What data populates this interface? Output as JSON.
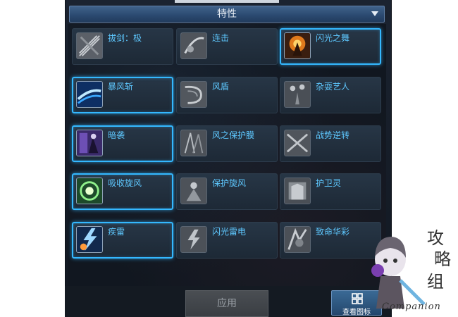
{
  "header": {
    "title": "特性"
  },
  "traits": [
    {
      "label": "拔剑：极",
      "icon": "sword-slash-icon",
      "active": false
    },
    {
      "label": "连击",
      "icon": "combo-strike-icon",
      "active": false
    },
    {
      "label": "闪光之舞",
      "icon": "flash-dance-icon",
      "active": true
    },
    {
      "label": "暴风斩",
      "icon": "storm-slash-icon",
      "active": true
    },
    {
      "label": "风盾",
      "icon": "wind-shield-icon",
      "active": false
    },
    {
      "label": "杂耍艺人",
      "icon": "juggler-icon",
      "active": false
    },
    {
      "label": "暗袭",
      "icon": "shadow-ambush-icon",
      "active": true
    },
    {
      "label": "风之保护膜",
      "icon": "wind-barrier-icon",
      "active": false
    },
    {
      "label": "战势逆转",
      "icon": "battle-reversal-icon",
      "active": false
    },
    {
      "label": "吸收旋风",
      "icon": "absorb-whirlwind-icon",
      "active": true
    },
    {
      "label": "保护旋风",
      "icon": "guard-whirlwind-icon",
      "active": false
    },
    {
      "label": "护卫灵",
      "icon": "guardian-spirit-icon",
      "active": false
    },
    {
      "label": "疾雷",
      "icon": "swift-thunder-icon",
      "active": true
    },
    {
      "label": "闪光雷电",
      "icon": "flash-lightning-icon",
      "active": false
    },
    {
      "label": "致命华彩",
      "icon": "deadly-brilliance-icon",
      "active": false
    }
  ],
  "footer": {
    "apply_label": "应用",
    "view_icons_label": "查看图标"
  },
  "watermark": {
    "text": "Companion"
  },
  "colors": {
    "accent": "#34b8ff",
    "label": "#5ec8ff",
    "header": "#2c4b72"
  }
}
